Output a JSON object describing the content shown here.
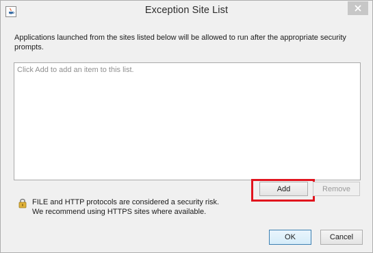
{
  "window": {
    "title": "Exception Site List",
    "app_icon": "java-icon",
    "close_icon": "close-icon"
  },
  "description": "Applications launched from the sites listed below will be allowed to run after the appropriate security prompts.",
  "site_list": {
    "placeholder": "Click Add to add an item to this list.",
    "items": []
  },
  "buttons": {
    "add": "Add",
    "remove": "Remove",
    "ok": "OK",
    "cancel": "Cancel"
  },
  "warning": {
    "icon": "lock-icon",
    "line1": "FILE and HTTP protocols are considered a security risk.",
    "line2": "We recommend using HTTPS sites where available."
  },
  "colors": {
    "highlight": "#e1141e",
    "window_bg": "#f0f0f0",
    "ok_border": "#3c7fb1"
  }
}
